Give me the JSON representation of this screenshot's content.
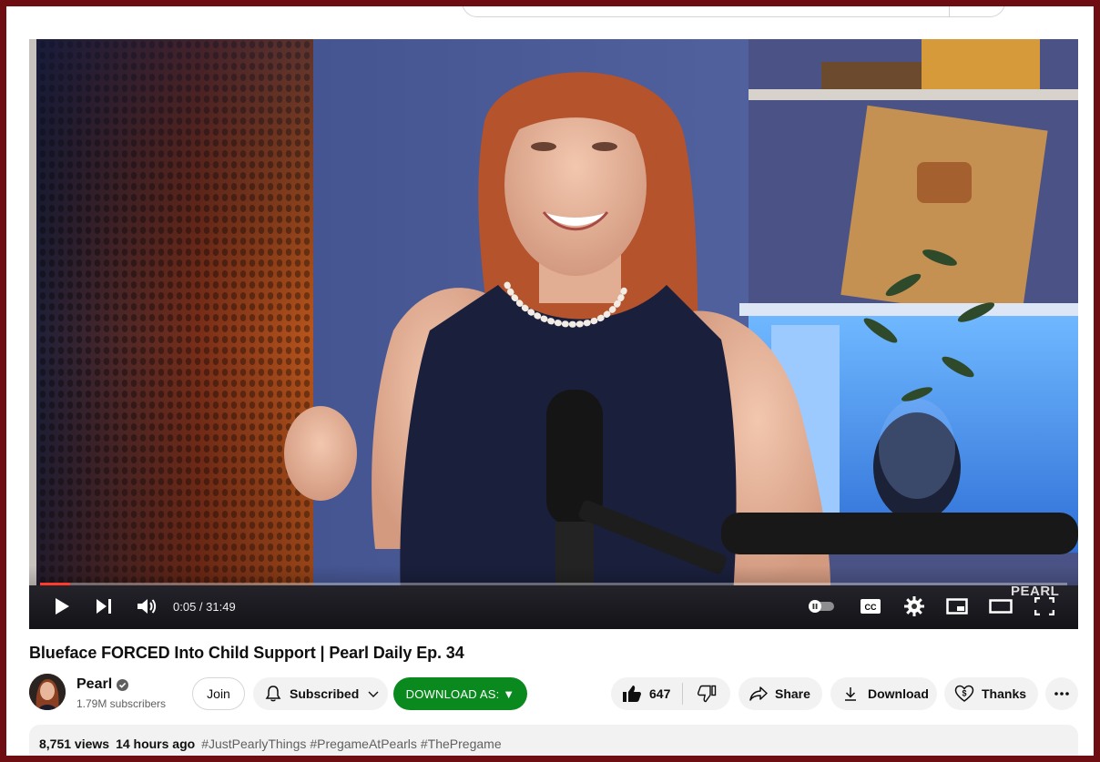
{
  "video": {
    "current_time": "0:05",
    "separator": " / ",
    "duration": "31:49",
    "progress_fraction": 0.003,
    "watermark": "PEARL"
  },
  "title": "Blueface FORCED Into Child Support | Pearl Daily Ep. 34",
  "channel": {
    "name": "Pearl",
    "subscribers": "1.79M subscribers"
  },
  "buttons": {
    "join": "Join",
    "subscribed": "Subscribed",
    "download_as": "DOWNLOAD AS: ▼",
    "likes": "647",
    "share": "Share",
    "download": "Download",
    "thanks": "Thanks"
  },
  "description": {
    "views": "8,751 views",
    "age": "14 hours ago",
    "tags": [
      "#JustPearlyThings",
      "#PregameAtPearls",
      "#ThePregame"
    ]
  },
  "colors": {
    "frame": "#6e0d12",
    "download_as_bg": "#0a8a1e",
    "progress": "#ff3b30"
  }
}
